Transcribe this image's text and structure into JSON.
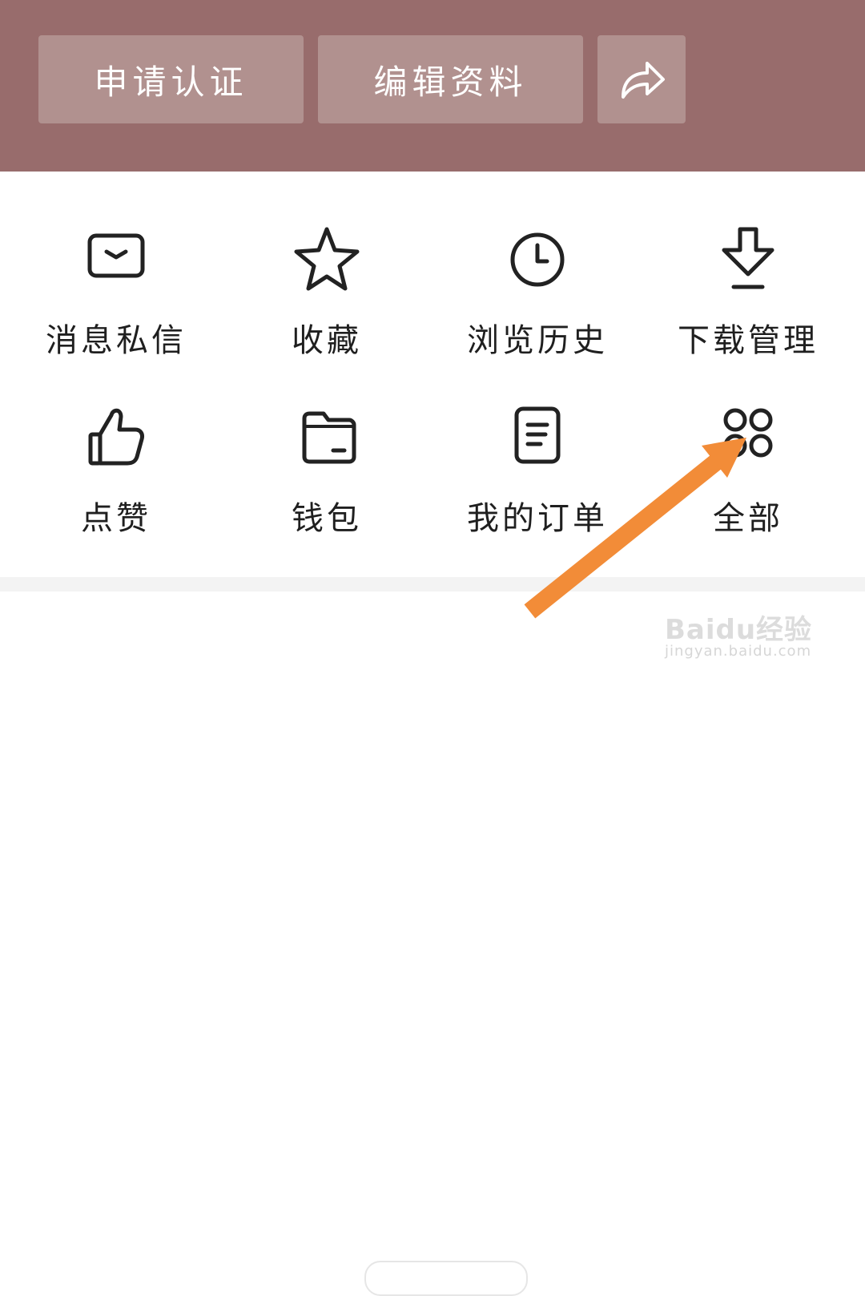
{
  "header": {
    "verify_label": "申请认证",
    "edit_label": "编辑资料",
    "share_icon": "share-icon",
    "background": "#986c6c",
    "button_background": "#b1918f"
  },
  "grid": {
    "items": [
      {
        "label": "消息私信",
        "icon": "mail-icon"
      },
      {
        "label": "收藏",
        "icon": "star-icon"
      },
      {
        "label": "浏览历史",
        "icon": "clock-icon"
      },
      {
        "label": "下载管理",
        "icon": "download-icon"
      },
      {
        "label": "点赞",
        "icon": "thumbs-up-icon"
      },
      {
        "label": "钱包",
        "icon": "wallet-icon"
      },
      {
        "label": "我的订单",
        "icon": "order-icon"
      },
      {
        "label": "全部",
        "icon": "grid-dots-icon"
      }
    ]
  },
  "annotation": {
    "arrow_color": "#f28c38"
  },
  "watermark": {
    "brand": "Baidu经验",
    "url": "jingyan.baidu.com"
  }
}
